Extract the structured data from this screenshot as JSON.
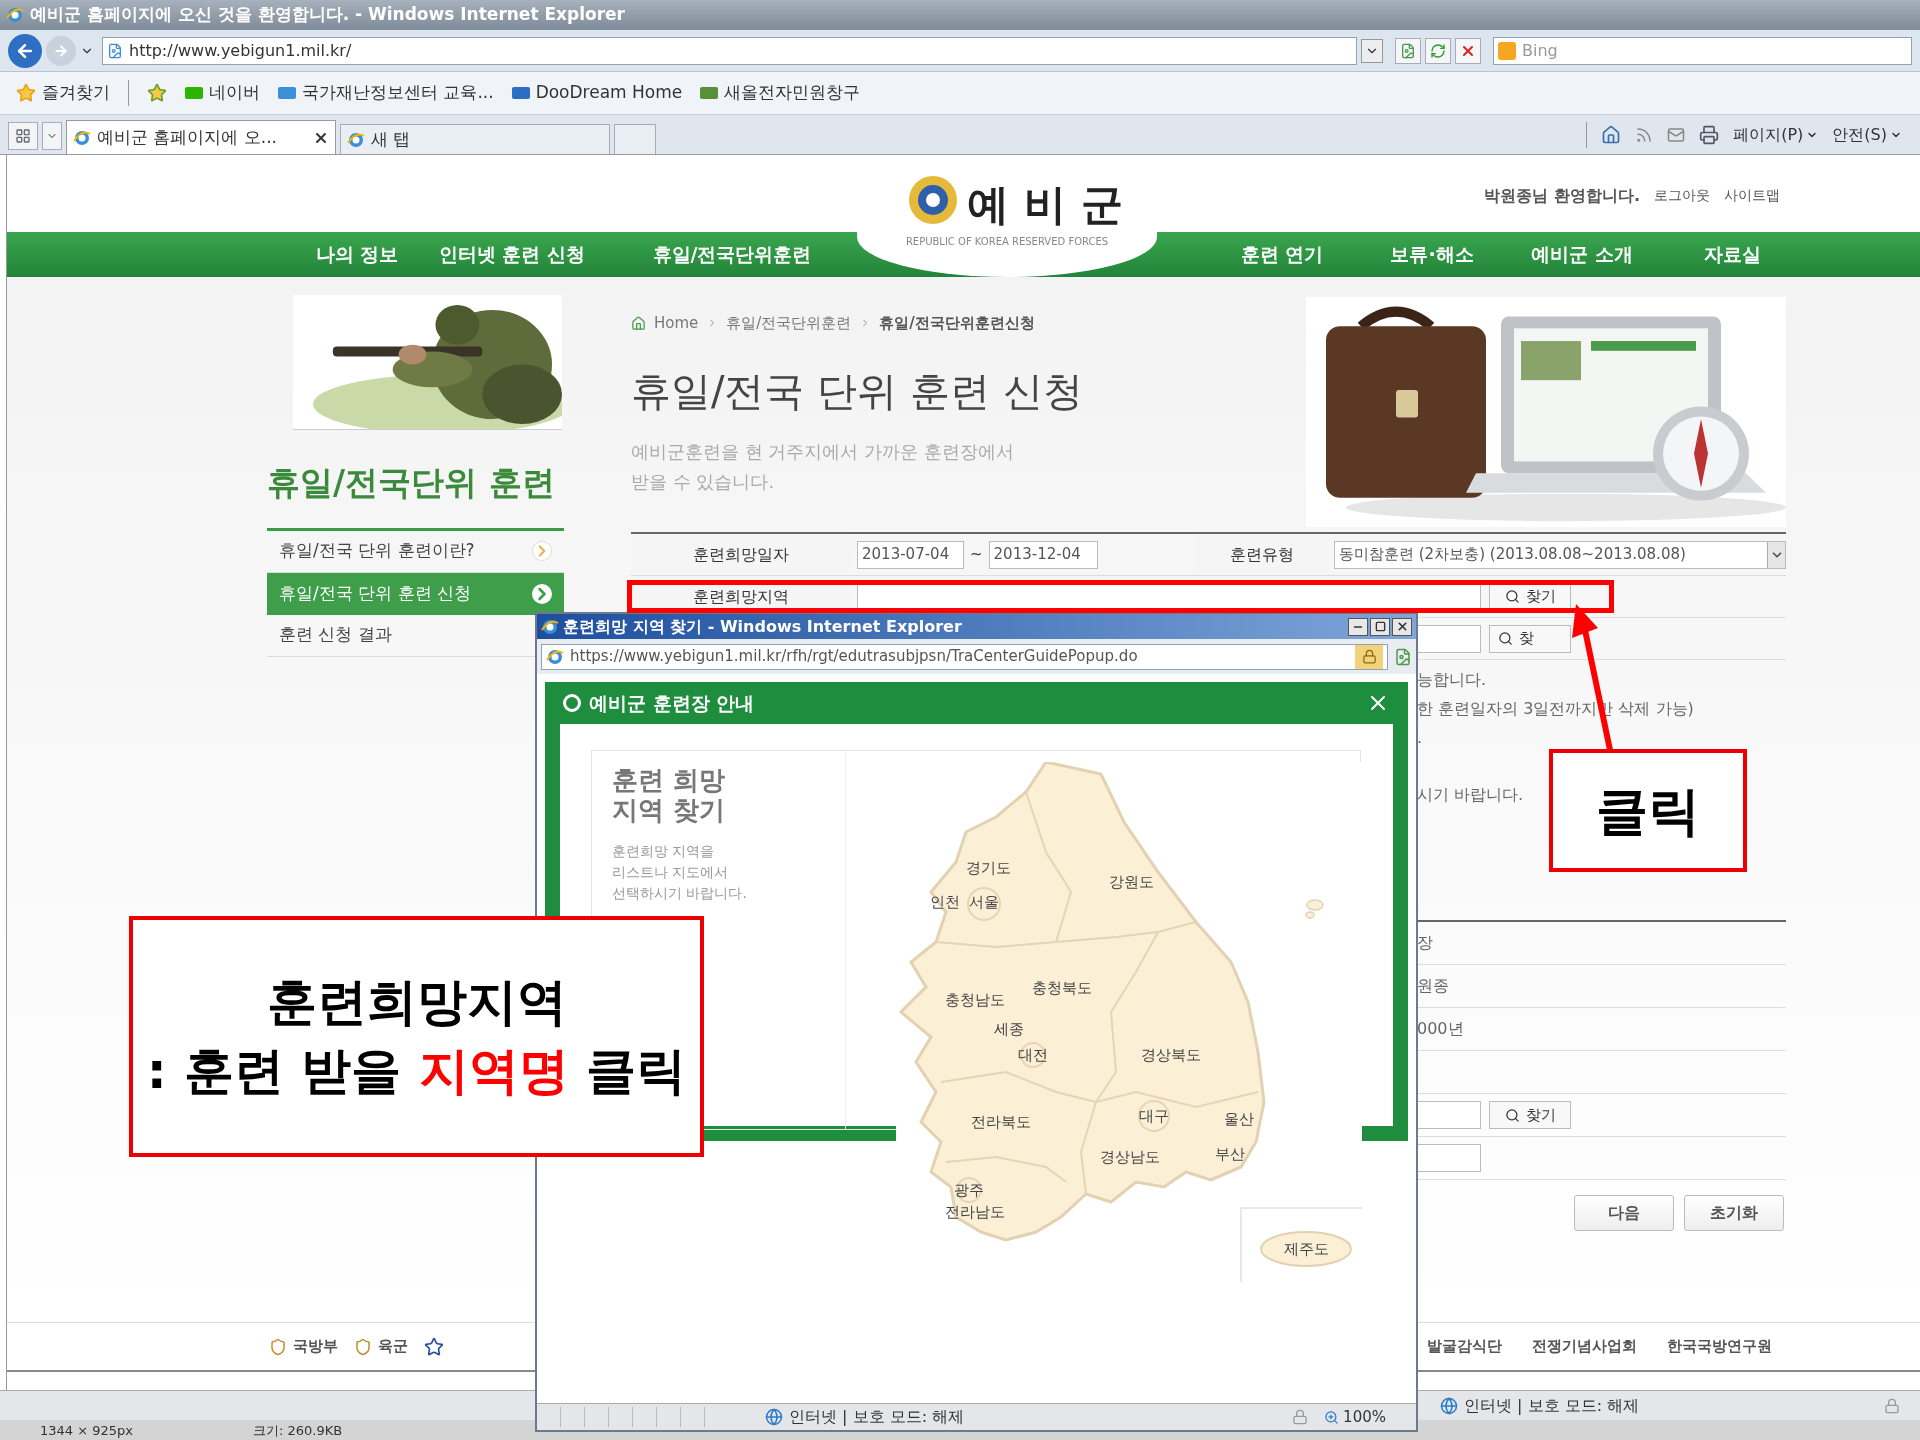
{
  "browser": {
    "title": "예비군 홈페이지에 오신 것을 환영합니다. - Windows Internet Explorer",
    "address": "http://www.yebigun1.mil.kr/",
    "search_placeholder": "Bing",
    "favorites_button": "즐겨찾기",
    "favorites": [
      "네이버",
      "국가재난정보센터 교육...",
      "DooDream Home",
      "새올전자민원창구"
    ],
    "tabs": [
      {
        "label": "예비군 홈페이지에 오...",
        "selected": true
      },
      {
        "label": "새 탭",
        "selected": false
      }
    ],
    "command_menus": [
      "페이지(P)",
      "안전(S)"
    ],
    "status": "인터넷 | 보호 모드: 해제",
    "info_strip": [
      "1344 × 925px",
      "크기: 260.9KB"
    ]
  },
  "site": {
    "logo": "예 비 군",
    "logo_subtitle": "REPUBLIC OF KOREA RESERVED FORCES",
    "welcome": "박원종님 환영합니다.",
    "header_links": [
      "로그아웃",
      "사이트맵"
    ],
    "nav_left": [
      "나의 정보",
      "인터넷 훈련 신청",
      "휴일/전국단위훈련"
    ],
    "nav_right": [
      "훈련 연기",
      "보류·해소",
      "예비군 소개",
      "자료실"
    ]
  },
  "sidebar": {
    "title": "휴일/전국단위 훈련",
    "items": [
      {
        "label": "휴일/전국 단위 훈련이란?",
        "selected": false
      },
      {
        "label": "휴일/전국 단위 훈련 신청",
        "selected": true
      },
      {
        "label": "훈련 신청 결과",
        "selected": false
      }
    ]
  },
  "breadcrumb": [
    "Home",
    "휴일/전국단위훈련",
    "휴일/전국단위훈련신청"
  ],
  "page_title": "휴일/전국 단위 훈련 신청",
  "intro": [
    "예비군훈련을 현 거주지에서 가까운 훈련장에서",
    "받을 수 있습니다."
  ],
  "form": {
    "date_label": "훈련희망일자",
    "date_from": "2013-07-04",
    "date_sep": "~",
    "date_to": "2013-12-04",
    "type_label": "훈련유형",
    "type_value": "동미참훈련 (2차보충) (2013.08.08~2013.08.08)",
    "region_label": "훈련희망지역",
    "search_button": "찾기",
    "row3_button": "찾"
  },
  "notes": [
    "능합니다.",
    "한 훈련일자의 3일전까지만 삭제 가능)",
    ".",
    "시기 바랍니다."
  ],
  "details": [
    {
      "kind": "text",
      "value": "장"
    },
    {
      "kind": "text",
      "value": "원종"
    },
    {
      "kind": "text",
      "value": "000년"
    },
    {
      "kind": "empty"
    },
    {
      "kind": "search",
      "button": "찾기"
    },
    {
      "kind": "input"
    }
  ],
  "actions": [
    "다음",
    "초기화"
  ],
  "footer": {
    "left": [
      "국방부",
      "육군"
    ],
    "right": [
      "발굴감식단",
      "전쟁기념사업회",
      "한국국방연구원"
    ]
  },
  "popup": {
    "title": "훈련희망 지역 찾기 - Windows Internet Explorer",
    "address": "https://www.yebigun1.mil.kr/rfh/rgt/edutrasubjpsn/TraCenterGuidePopup.do",
    "header": "예비군 훈련장 안내",
    "panel_title": [
      "훈련 희망",
      "지역 찾기"
    ],
    "panel_text": [
      "훈련희망 지역을",
      "리스트나 지도에서",
      "선택하시기 바랍니다."
    ],
    "regions": [
      "경기도",
      "강원도",
      "인천",
      "서울",
      "충청남도",
      "충청북도",
      "세종",
      "대전",
      "경상북도",
      "전라북도",
      "대구",
      "울산",
      "경상남도",
      "부산",
      "광주",
      "전라남도",
      "제주도"
    ],
    "status": "인터넷 | 보호 모드: 해제",
    "zoom": "100%"
  },
  "annotations": {
    "region_note": {
      "title": "훈련희망지역",
      "parts": [
        {
          "text": ": 훈련 받을 ",
          "emphasis": false
        },
        {
          "text": "지역명",
          "emphasis": true
        },
        {
          "text": " 클릭",
          "emphasis": false
        }
      ]
    },
    "click_note": "클릭"
  }
}
